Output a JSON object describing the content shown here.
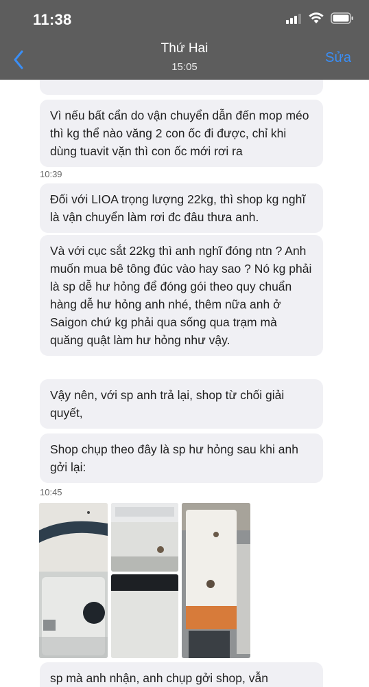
{
  "status_bar": {
    "time": "11:38"
  },
  "nav": {
    "title": "Thứ Hai",
    "subtitle": "15:05",
    "edit_label": "Sửa"
  },
  "messages": [
    {
      "text": "Vì nếu bất cẩn do vận chuyển dẫn đến mop méo thì kg thể nào văng 2 con ốc đi được, chỉ khi dùng tuavit vặn thì con ốc mới rơi ra"
    },
    {
      "text": "Đối với LIOA trọng lượng 22kg, thì shop kg nghĩ là vận chuyển làm rơi đc đâu thưa anh."
    },
    {
      "text": "Và với cục sắt 22kg thì anh nghĩ đóng ntn ? Anh muốn mua bê tông đúc vào hay sao ? Nó kg phải là sp dễ hư hỏng để đóng gói theo quy chuẩn hàng dễ hư hỏng anh nhé, thêm nữa anh ở Saigon chứ kg phải qua sống qua trạm mà quăng quật làm hư hỏng như vậy."
    },
    {
      "text": "Vậy nên, với sp anh trả lại, shop từ chối giải quyết,"
    },
    {
      "text": "Shop chụp theo đây là sp hư hỏng sau khi anh gởi lại:"
    },
    {
      "text": "sp mà anh nhận, anh chụp gởi shop, vẫn"
    }
  ],
  "timestamps": [
    "10:39",
    "10:45"
  ],
  "colors": {
    "header_bg": "#5d5d5d",
    "accent": "#3a8ef6",
    "bubble_bg": "#f0f0f4"
  }
}
